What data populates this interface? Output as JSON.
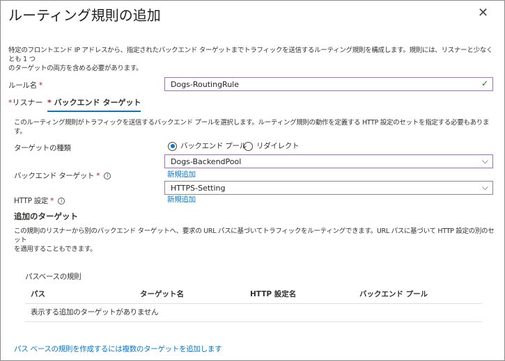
{
  "title": "ルーティング規則の追加",
  "description": "特定のフロントエンド IP アドレスから、指定されたバックエンド ターゲットまでトラフィックを送信するルーティング規則を構成します。規則には、リスナーと少なくとも 1 つ",
  "description2": "のターゲットの両方を含める必要があります。",
  "rule_name": {
    "label": "ルール名",
    "value": "Dogs-RoutingRule"
  },
  "tabs": [
    {
      "label": "リスナー"
    },
    {
      "label": "バックエンド ターゲット",
      "active": true
    }
  ],
  "backend": {
    "description": "このルーティング規則がトラフィックを送信するバックエンド プールを選択します。ルーティング規則の動作を定義する HTTP 設定のセットを指定する必要もあります。",
    "target_type_label": "ターゲットの種類",
    "radio_options": [
      {
        "label": "バックエンド プール",
        "selected": true
      },
      {
        "label": "リダイレクト",
        "selected": false
      }
    ],
    "backend_target_label": "バックエンド ターゲット",
    "backend_target_value": "Dogs-BackendPool",
    "add_new": "新規追加",
    "http_label": "HTTP 設定",
    "http_value": "HTTPS-Setting"
  },
  "additional": {
    "heading": "追加のターゲット",
    "description": "この規則のリスナーから別のバックエンド ターゲットへ、要求の URL パスに基づいてトラフィックをルーティングできます。URL パスに基づいて HTTP 設定の別のセット",
    "description2": "を適用することもできます。",
    "path_rules_label": "パスベースの規則",
    "columns": [
      "パス",
      "ターゲット名",
      "HTTP 設定名",
      "バックエンド プール"
    ],
    "empty": "表示する追加のターゲットがありません",
    "footer_link": "パス ベースの規則を作成するには複数のターゲットを追加します"
  },
  "colors": {
    "accent": "#0078d4",
    "required": "#a4262c",
    "focus_border": "#a56fc1",
    "valid": "#107c10"
  }
}
